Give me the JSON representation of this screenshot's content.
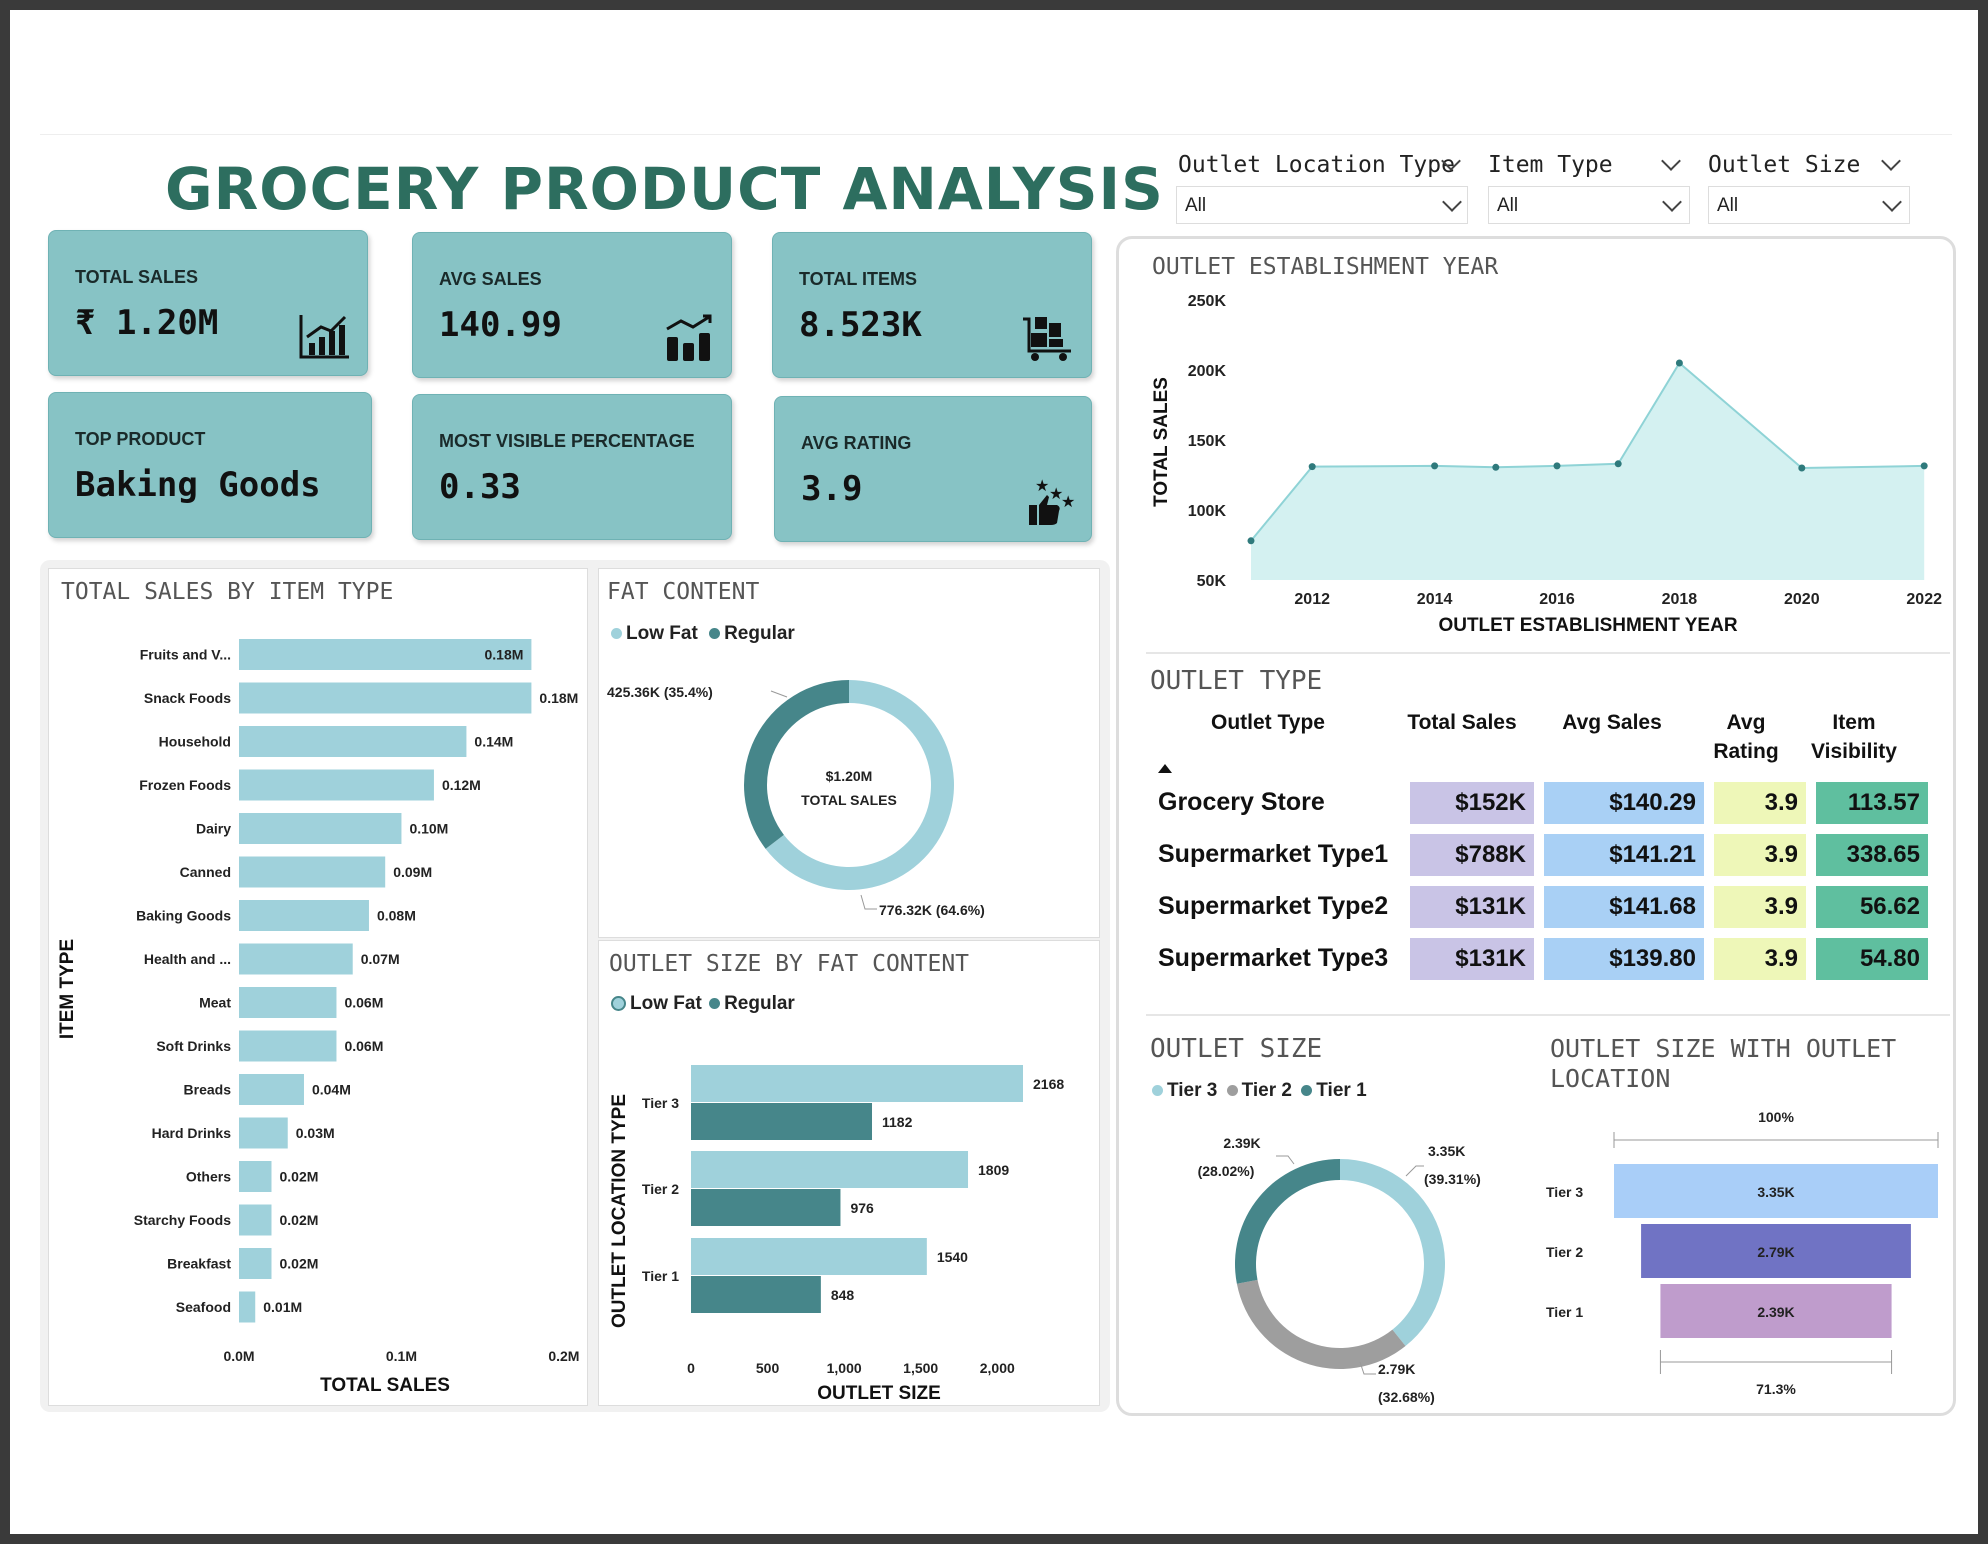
{
  "title": "GROCERY PRODUCT ANALYSIS",
  "slicers": [
    {
      "label": "Outlet Location Type",
      "value": "All"
    },
    {
      "label": "Item Type",
      "value": "All"
    },
    {
      "label": "Outlet Size",
      "value": "All"
    }
  ],
  "cards": [
    {
      "label": "TOTAL SALES",
      "value": "₹ 1.20M",
      "icon": "chart-growth-icon"
    },
    {
      "label": "AVG SALES",
      "value": "140.99",
      "icon": "bar-trend-icon"
    },
    {
      "label": "TOTAL ITEMS",
      "value": "8.523K",
      "icon": "cart-boxes-icon"
    },
    {
      "label": "TOP PRODUCT",
      "value": "Baking Goods",
      "icon": ""
    },
    {
      "label": "MOST VISIBLE PERCENTAGE",
      "value": "0.33",
      "icon": ""
    },
    {
      "label": "AVG RATING",
      "value": "3.9",
      "icon": "thumbs-up-stars-icon"
    }
  ],
  "item_type_chart": {
    "title": "TOTAL SALES BY ITEM TYPE",
    "xlabel": "TOTAL SALES",
    "ylabel": "ITEM TYPE"
  },
  "fat_content": {
    "title": "FAT CONTENT",
    "legend": [
      "Low Fat",
      "Regular"
    ],
    "center_value": "$1.20M",
    "center_label": "TOTAL SALES",
    "label_regular": "425.36K (35.4%)",
    "label_lowfat": "776.32K (64.6%)"
  },
  "outlet_size_fat": {
    "title": "OUTLET SIZE BY FAT CONTENT",
    "legend": [
      "Low Fat",
      "Regular"
    ],
    "xlabel": "OUTLET SIZE",
    "ylabel": "OUTLET LOCATION TYPE"
  },
  "establishment": {
    "title": "OUTLET ESTABLISHMENT YEAR",
    "xlabel": "OUTLET ESTABLISHMENT YEAR",
    "ylabel": "TOTAL SALES"
  },
  "outlet_type": {
    "title": "OUTLET TYPE",
    "headers": [
      "Outlet Type",
      "Total Sales",
      "Avg Sales",
      "Avg Rating",
      "Item Visibility"
    ],
    "rows": [
      {
        "name": "Grocery Store",
        "total": "$152K",
        "avg": "$140.29",
        "rating": "3.9",
        "visibility": "113.57"
      },
      {
        "name": "Supermarket Type1",
        "total": "$788K",
        "avg": "$141.21",
        "rating": "3.9",
        "visibility": "338.65"
      },
      {
        "name": "Supermarket Type2",
        "total": "$131K",
        "avg": "$141.68",
        "rating": "3.9",
        "visibility": "56.62"
      },
      {
        "name": "Supermarket Type3",
        "total": "$131K",
        "avg": "$139.80",
        "rating": "3.9",
        "visibility": "54.80"
      }
    ],
    "colors": {
      "total": "#c9c4e6",
      "avg": "#a9d0f5",
      "rating": "#eef7b8",
      "visibility": "#5fbf9f"
    }
  },
  "outlet_size": {
    "title": "OUTLET SIZE",
    "legend": [
      "Tier 3",
      "Tier 2",
      "Tier 1"
    ],
    "label_tier3": [
      "3.35K",
      "(39.31%)"
    ],
    "label_tier2": [
      "2.79K",
      "(32.68%)"
    ],
    "label_tier1": [
      "2.39K",
      "(28.02%)"
    ]
  },
  "funnel": {
    "title_line1": "OUTLET SIZE WITH OUTLET",
    "title_line2": "LOCATION",
    "top_pct": "100%",
    "bottom_pct": "71.3%"
  },
  "colors": {
    "teal": "#87c3c5",
    "light": "#9fd1db",
    "dark": "#46868a",
    "gray": "#9e9e9e",
    "title": "#2d6e5f"
  },
  "chart_data": [
    {
      "type": "bar",
      "orientation": "horizontal",
      "title": "TOTAL SALES BY ITEM TYPE",
      "xlabel": "TOTAL SALES",
      "ylabel": "ITEM TYPE",
      "categories": [
        "Fruits and V...",
        "Snack Foods",
        "Household",
        "Frozen Foods",
        "Dairy",
        "Canned",
        "Baking Goods",
        "Health and ...",
        "Meat",
        "Soft Drinks",
        "Breads",
        "Hard Drinks",
        "Others",
        "Starchy Foods",
        "Breakfast",
        "Seafood"
      ],
      "values": [
        0.18,
        0.18,
        0.14,
        0.12,
        0.1,
        0.09,
        0.08,
        0.07,
        0.06,
        0.06,
        0.04,
        0.03,
        0.02,
        0.02,
        0.02,
        0.01
      ],
      "value_labels": [
        "0.18M",
        "0.18M",
        "0.14M",
        "0.12M",
        "0.10M",
        "0.09M",
        "0.08M",
        "0.07M",
        "0.06M",
        "0.06M",
        "0.04M",
        "0.03M",
        "0.02M",
        "0.02M",
        "0.02M",
        "0.01M"
      ],
      "xticks": [
        "0.0M",
        "0.1M",
        "0.2M"
      ],
      "xlim": [
        0,
        0.2
      ]
    },
    {
      "type": "pie",
      "title": "FAT CONTENT",
      "categories": [
        "Low Fat",
        "Regular"
      ],
      "values": [
        776.32,
        425.36
      ],
      "colors": [
        "#9fd1db",
        "#46868a"
      ]
    },
    {
      "type": "bar",
      "orientation": "horizontal",
      "title": "OUTLET SIZE BY FAT CONTENT",
      "xlabel": "OUTLET SIZE",
      "ylabel": "OUTLET LOCATION TYPE",
      "categories": [
        "Tier 3",
        "Tier 2",
        "Tier 1"
      ],
      "series": [
        {
          "name": "Low Fat",
          "values": [
            2168,
            1809,
            1540
          ]
        },
        {
          "name": "Regular",
          "values": [
            1182,
            976,
            848
          ]
        }
      ],
      "xticks": [
        "0",
        "500",
        "1,000",
        "1,500",
        "2,000"
      ],
      "xlim": [
        0,
        2500
      ]
    },
    {
      "type": "area",
      "title": "OUTLET ESTABLISHMENT YEAR",
      "xlabel": "OUTLET ESTABLISHMENT YEAR",
      "ylabel": "TOTAL SALES",
      "x": [
        2011,
        2012,
        2014,
        2015,
        2016,
        2017,
        2018,
        2020,
        2022
      ],
      "values": [
        78000,
        131000,
        131500,
        130500,
        131500,
        133000,
        205000,
        130000,
        131500
      ],
      "xticks": [
        "2012",
        "2014",
        "2016",
        "2018",
        "2020",
        "2022"
      ],
      "yticks": [
        "50K",
        "100K",
        "150K",
        "200K",
        "250K"
      ],
      "ylim": [
        50000,
        250000
      ]
    },
    {
      "type": "pie",
      "title": "OUTLET SIZE",
      "categories": [
        "Tier 3",
        "Tier 2",
        "Tier 1"
      ],
      "values": [
        3350,
        2790,
        2390
      ],
      "colors": [
        "#9fd1db",
        "#9e9e9e",
        "#46868a"
      ]
    },
    {
      "type": "bar",
      "orientation": "funnel",
      "title": "OUTLET SIZE WITH OUTLET LOCATION",
      "categories": [
        "Tier 3",
        "Tier 2",
        "Tier 1"
      ],
      "values": [
        3350,
        2790,
        2390
      ],
      "value_labels": [
        "3.35K",
        "2.79K",
        "2.39K"
      ],
      "colors": [
        "#a9cef8",
        "#7073c4",
        "#bf9ccc"
      ]
    }
  ]
}
